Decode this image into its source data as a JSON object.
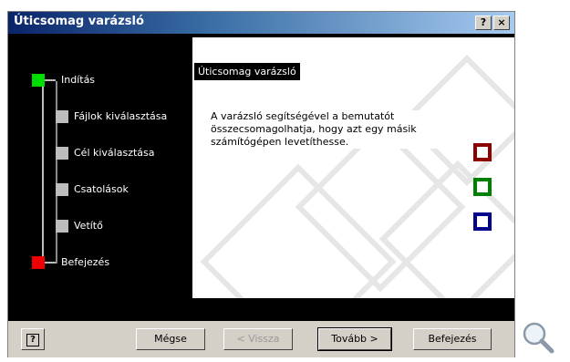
{
  "window": {
    "title": "Úticsomag varázsló",
    "help_glyph": "?",
    "close_glyph": "×"
  },
  "steps": [
    {
      "label": "Indítás",
      "state": "current",
      "color": "#00dd00"
    },
    {
      "label": "Fájlok kiválasztása",
      "state": "pending",
      "color": "#bdbdbd"
    },
    {
      "label": "Cél kiválasztása",
      "state": "pending",
      "color": "#bdbdbd"
    },
    {
      "label": "Csatolások",
      "state": "pending",
      "color": "#bdbdbd"
    },
    {
      "label": "Vetítő",
      "state": "pending",
      "color": "#bdbdbd"
    },
    {
      "label": "Befejezés",
      "state": "final",
      "color": "#ee0000"
    }
  ],
  "panel": {
    "title": "Úticsomag varázsló",
    "description": "A varázsló segítségével a bemutatót összecsomagolhatja, hogy azt egy másik számítógépen levetíthesse."
  },
  "decor_boxes": [
    {
      "name": "red-box",
      "color": "#8b0000"
    },
    {
      "name": "green-box",
      "color": "#008000"
    },
    {
      "name": "blue-box",
      "color": "#00008b"
    }
  ],
  "buttons": {
    "help_glyph": "?",
    "cancel": "Mégse",
    "back": "< Vissza",
    "next": "Tovább >",
    "finish": "Befejezés"
  },
  "icons": {
    "magnifier": "magnifier-icon"
  }
}
